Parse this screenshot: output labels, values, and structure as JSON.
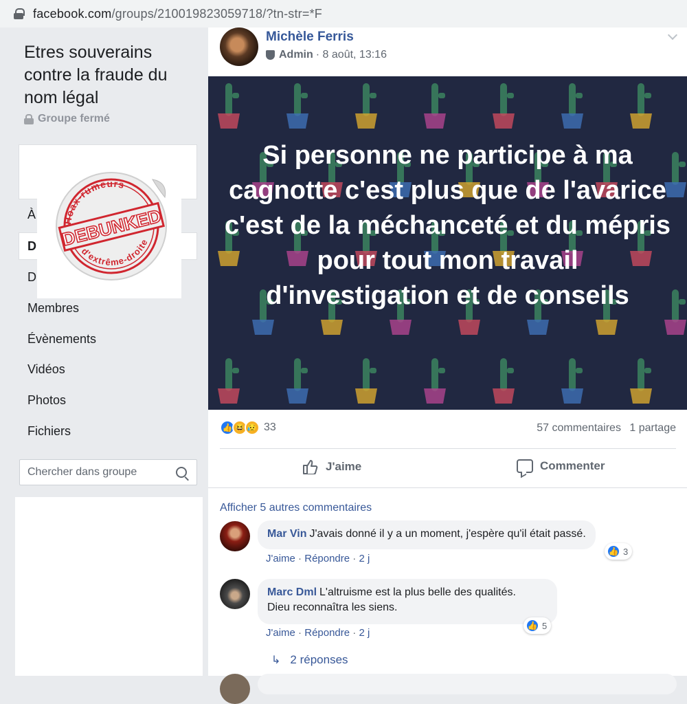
{
  "browser": {
    "url_host": "facebook.com",
    "url_path": "/groups/210019823059718/?tn-str=*F"
  },
  "group": {
    "title": "Etres souverains contre la fraude du nom légal",
    "type": "Groupe fermé",
    "nav": {
      "item_a": "À",
      "item_d1": "D",
      "item_d2": "D",
      "members": "Membres",
      "events": "Évènements",
      "videos": "Vidéos",
      "photos": "Photos",
      "files": "Fichiers"
    },
    "search_placeholder": "Chercher dans groupe"
  },
  "stamp": {
    "top_text": "Hoax-rumeurs",
    "main_text": "DEBUNKED",
    "bottom_text": "d'extrême-droite"
  },
  "post": {
    "author": "Michèle Ferris",
    "role": "Admin",
    "date": "· 8 août, 13:16",
    "banner_text": "Si personne ne participe à ma cagnotte c'est plus que de l'avarice c'est de la méchanceté et du mépris pour tout mon travail d'investigation et de conseils",
    "reaction_count": "33",
    "comment_count": "57 commentaires",
    "share_count": "1 partage",
    "like_label": "J'aime",
    "comment_label": "Commenter"
  },
  "comments": {
    "more_label": "Afficher 5 autres commentaires",
    "items": [
      {
        "name": "Mar Vin",
        "text": "J'avais donné il y a un moment, j'espère qu'il était passé.",
        "like": "J'aime",
        "reply": "Répondre",
        "time": "2 j",
        "reactions": "3"
      },
      {
        "name": "Marc Dml",
        "text": "L'altruisme est la plus belle des qualités.",
        "text2": "Dieu reconnaîtra les siens.",
        "like": "J'aime",
        "reply": "Répondre",
        "time": "2 j",
        "reactions": "5"
      }
    ],
    "replies_label": "2 réponses"
  },
  "colors": {
    "link": "#385898",
    "banner_bg": "#212841",
    "like_blue": "#2078f4",
    "stamp_red": "#d0262f"
  },
  "icons": [
    "lock-icon",
    "search-icon",
    "shield-icon",
    "chevron-down-icon",
    "like-icon",
    "haha-icon",
    "sad-icon",
    "thumb-icon",
    "comment-icon",
    "reply-arrow-icon"
  ]
}
